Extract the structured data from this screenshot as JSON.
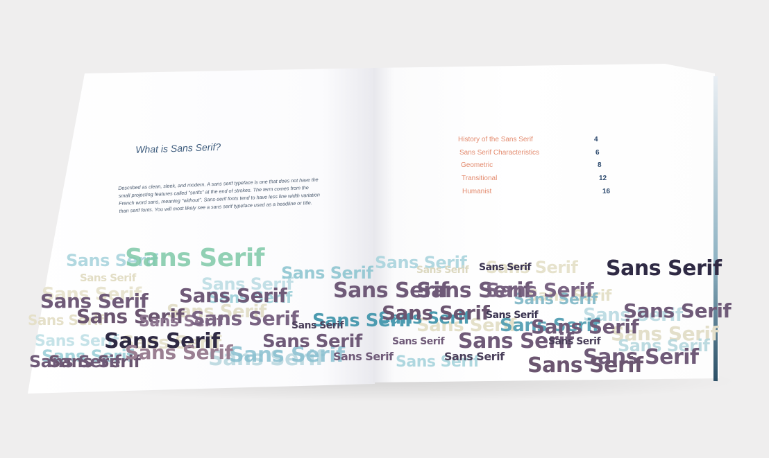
{
  "left_page": {
    "title": "What is Sans Serif?",
    "body": "Described as clean, sleek, and modern. A sans serif typeface is one that does not have the small projecting features called \"serifs\" at the end of strokes. The term comes from the French word sans, meaning \"without\". Sans-serif fonts tend to have less line width variation than serif fonts. You will most likely see a sans serif typeface used as a headline or title."
  },
  "toc": [
    {
      "label": "History of the Sans Serif",
      "page": "4"
    },
    {
      "label": "Sans Serif Characteristics",
      "page": "6"
    },
    {
      "label": "Geometric",
      "page": "8"
    },
    {
      "label": "Transitional",
      "page": "12"
    },
    {
      "label": "Humanist",
      "page": "16"
    }
  ],
  "pattern_word": "Sans Serif",
  "colors": {
    "background": "#efeeee",
    "title": "#3f5d7e",
    "toc_label": "#e38a6d",
    "toc_number": "#2d4a6e",
    "pattern": [
      "#2f2a44",
      "#6f5a78",
      "#4c9bb0",
      "#8fc6d1",
      "#7fc9a8",
      "#e4e0c8",
      "#9a7f92"
    ]
  }
}
